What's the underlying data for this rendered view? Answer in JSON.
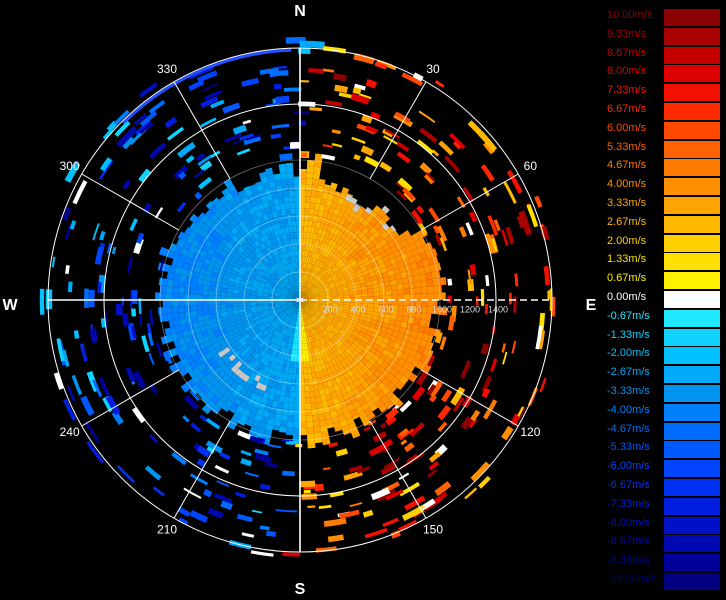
{
  "chart_data": {
    "type": "polar-radar",
    "compass": {
      "north": "N",
      "east": "E",
      "south": "S",
      "west": "W"
    },
    "bearing_labels": [
      "30",
      "60",
      "120",
      "150",
      "210",
      "240",
      "300",
      "330"
    ],
    "range_labels": [
      "200",
      "400",
      "600",
      "800",
      "1000",
      "1200",
      "1400"
    ],
    "legend": {
      "entries": [
        {
          "label": "10.00m/s",
          "color": "#8b0000"
        },
        {
          "label": "9.33m/s",
          "color": "#a80000"
        },
        {
          "label": "8.67m/s",
          "color": "#c40000"
        },
        {
          "label": "8.00m/s",
          "color": "#de0000"
        },
        {
          "label": "7.33m/s",
          "color": "#f21000"
        },
        {
          "label": "6.67m/s",
          "color": "#ff2a00"
        },
        {
          "label": "6.00m/s",
          "color": "#ff4800"
        },
        {
          "label": "5.33m/s",
          "color": "#ff6200"
        },
        {
          "label": "4.67m/s",
          "color": "#ff7a00"
        },
        {
          "label": "4.00m/s",
          "color": "#ff8f00"
        },
        {
          "label": "3.33m/s",
          "color": "#ffa400"
        },
        {
          "label": "2.67m/s",
          "color": "#ffba00"
        },
        {
          "label": "2.00m/s",
          "color": "#ffcf00"
        },
        {
          "label": "1.33m/s",
          "color": "#ffe000"
        },
        {
          "label": "0.67m/s",
          "color": "#fff000"
        },
        {
          "label": "0.00m/s",
          "color": "#ffffff"
        },
        {
          "label": "-0.67m/s",
          "color": "#20e8ff"
        },
        {
          "label": "-1.33m/s",
          "color": "#10d4ff"
        },
        {
          "label": "-2.00m/s",
          "color": "#00c0ff"
        },
        {
          "label": "-2.67m/s",
          "color": "#00aaf8"
        },
        {
          "label": "-3.33m/s",
          "color": "#0094f0"
        },
        {
          "label": "-4.00m/s",
          "color": "#0080ff"
        },
        {
          "label": "-4.67m/s",
          "color": "#006cff"
        },
        {
          "label": "-5.33m/s",
          "color": "#0058ff"
        },
        {
          "label": "-6.00m/s",
          "color": "#0044ff"
        },
        {
          "label": "-6.67m/s",
          "color": "#0030f0"
        },
        {
          "label": "-7.33m/s",
          "color": "#001ee0"
        },
        {
          "label": "-8.00m/s",
          "color": "#0010c8"
        },
        {
          "label": "-8.67m/s",
          "color": "#0008b0"
        },
        {
          "label": "-9.33m/s",
          "color": "#000098"
        },
        {
          "label": "-10.00m/s",
          "color": "#000080"
        }
      ]
    },
    "field": {
      "description_units": "radial velocity m/s",
      "dense_region_max_range": 1000,
      "approaching_sector_deg": [
        180,
        360
      ],
      "receding_sector_deg": [
        0,
        180
      ],
      "zero_line": "N-S axis, white dashed toward E"
    },
    "colors": {
      "background": "#000000",
      "rings": "#ffffff",
      "spokes": "#ffffff"
    }
  }
}
